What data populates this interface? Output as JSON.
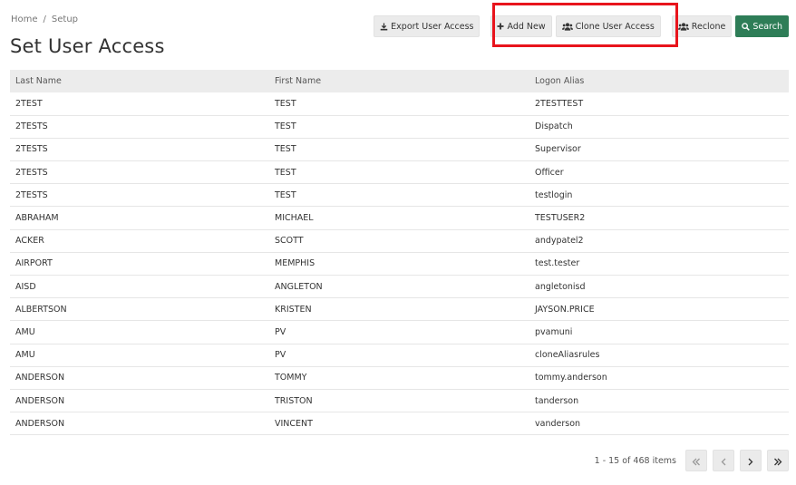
{
  "breadcrumb": {
    "home": "Home",
    "separator": "/",
    "current": "Setup"
  },
  "page_title": "Set User Access",
  "toolbar": {
    "export_label": "Export User Access",
    "add_new_label": "Add New",
    "clone_label": "Clone User Access",
    "reclone_label": "Reclone",
    "search_label": "Search"
  },
  "table": {
    "headers": {
      "last": "Last Name",
      "first": "First Name",
      "alias": "Logon Alias"
    },
    "rows": [
      {
        "last": "2TEST",
        "first": "TEST",
        "alias": "2TESTTEST"
      },
      {
        "last": "2TESTS",
        "first": "TEST",
        "alias": "Dispatch"
      },
      {
        "last": "2TESTS",
        "first": "TEST",
        "alias": "Supervisor"
      },
      {
        "last": "2TESTS",
        "first": "TEST",
        "alias": "Officer"
      },
      {
        "last": "2TESTS",
        "first": "TEST",
        "alias": "testlogin"
      },
      {
        "last": "ABRAHAM",
        "first": "MICHAEL",
        "alias": "TESTUSER2"
      },
      {
        "last": "ACKER",
        "first": "SCOTT",
        "alias": "andypatel2"
      },
      {
        "last": "AIRPORT",
        "first": "MEMPHIS",
        "alias": "test.tester"
      },
      {
        "last": "AISD",
        "first": "ANGLETON",
        "alias": "angletonisd"
      },
      {
        "last": "ALBERTSON",
        "first": "KRISTEN",
        "alias": "JAYSON.PRICE"
      },
      {
        "last": "AMU",
        "first": "PV",
        "alias": "pvamuni"
      },
      {
        "last": "AMU",
        "first": "PV",
        "alias": "cloneAliasrules"
      },
      {
        "last": "ANDERSON",
        "first": "TOMMY",
        "alias": "tommy.anderson"
      },
      {
        "last": "ANDERSON",
        "first": "TRISTON",
        "alias": "tanderson"
      },
      {
        "last": "ANDERSON",
        "first": "VINCENT",
        "alias": "vanderson"
      }
    ]
  },
  "pager": {
    "info": "1 - 15 of 468 items"
  },
  "icons": {
    "export": "download-icon",
    "add": "plus-icon",
    "clone": "users-icon",
    "reclone": "users-icon",
    "search": "search-icon",
    "first_page": "double-chevron-left-icon",
    "prev_page": "chevron-left-icon",
    "next_page": "chevron-right-icon",
    "last_page": "double-chevron-right-icon"
  },
  "colors": {
    "primary": "#2e7d57",
    "highlight": "#e8141c",
    "header_bg": "#ececec",
    "button_bg": "#ebebeb"
  }
}
